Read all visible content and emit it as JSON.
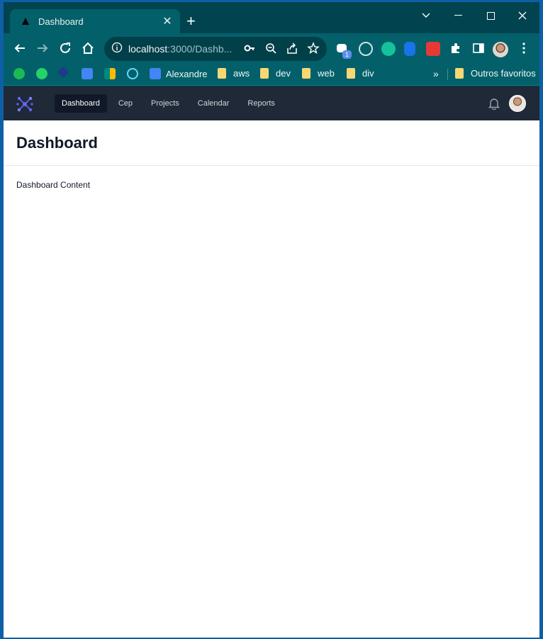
{
  "browser": {
    "tab": {
      "title": "Dashboard",
      "favicon": "vercel-triangle-icon"
    },
    "window_controls": [
      "tab-search-icon",
      "minimize-icon",
      "maximize-icon",
      "close-icon"
    ],
    "address": {
      "host": "localhost",
      "path": ":3000/Dashb...",
      "icons": [
        "info-icon",
        "key-icon",
        "zoom-icon",
        "share-icon",
        "star-icon"
      ]
    },
    "extensions": [
      "cast-badge-icon",
      "target-icon",
      "grammarly-icon",
      "tool-icon",
      "puzzle-red-icon",
      "puzzle-icon",
      "sidebar-icon"
    ],
    "extension_badge": "1",
    "bookmarks": {
      "items": [
        {
          "label": "",
          "icon": "spotify-icon",
          "color": "#1db954"
        },
        {
          "label": "",
          "icon": "whatsapp-icon",
          "color": "#25d366"
        },
        {
          "label": "",
          "icon": "cube-icon",
          "color": "#1e3a8a"
        },
        {
          "label": "",
          "icon": "translate-icon",
          "color": "#4285f4"
        },
        {
          "label": "",
          "icon": "meet-icon",
          "color": "#00897b"
        },
        {
          "label": "",
          "icon": "react-icon",
          "color": "#61dafb"
        },
        {
          "label": "Alexandre",
          "icon": "calendar-icon",
          "color": "#4285f4"
        }
      ],
      "folders": [
        "aws",
        "dev",
        "web",
        "div"
      ],
      "overflow": "»",
      "other": "Outros favoritos"
    }
  },
  "app": {
    "nav": {
      "links": [
        "Dashboard",
        "Cep",
        "Projects",
        "Calendar",
        "Reports"
      ],
      "active": "Dashboard"
    },
    "page_title": "Dashboard",
    "content_text": "Dashboard Content",
    "colors": {
      "nav_bg": "#1f2937",
      "active_bg": "#111827",
      "logo": "#6366f1"
    }
  }
}
